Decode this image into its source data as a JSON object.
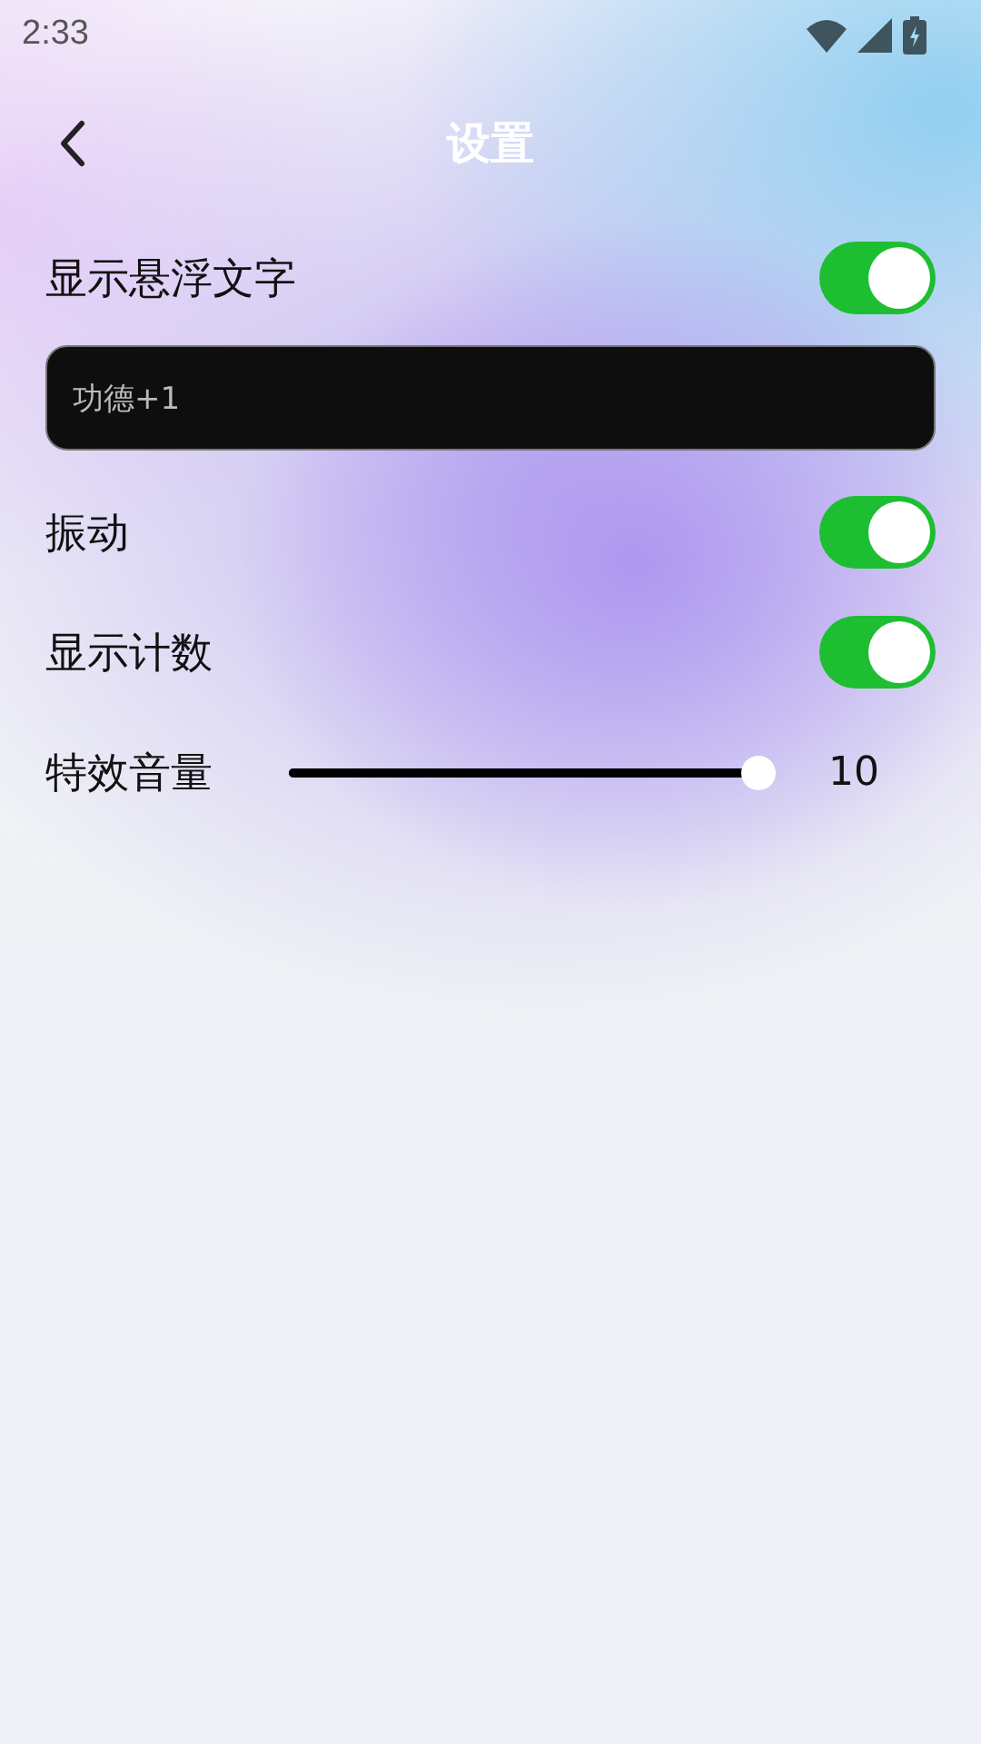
{
  "status_bar": {
    "time": "2:33"
  },
  "header": {
    "title": "设置"
  },
  "settings": [
    {
      "kind": "toggle",
      "label": "显示悬浮文字",
      "on": true
    },
    {
      "kind": "field",
      "value": "功德+1"
    },
    {
      "kind": "toggle",
      "label": "振动",
      "on": true
    },
    {
      "kind": "toggle",
      "label": "显示计数",
      "on": true
    },
    {
      "kind": "slider",
      "label": "特效音量",
      "level": 1.0,
      "reading": "10"
    }
  ]
}
